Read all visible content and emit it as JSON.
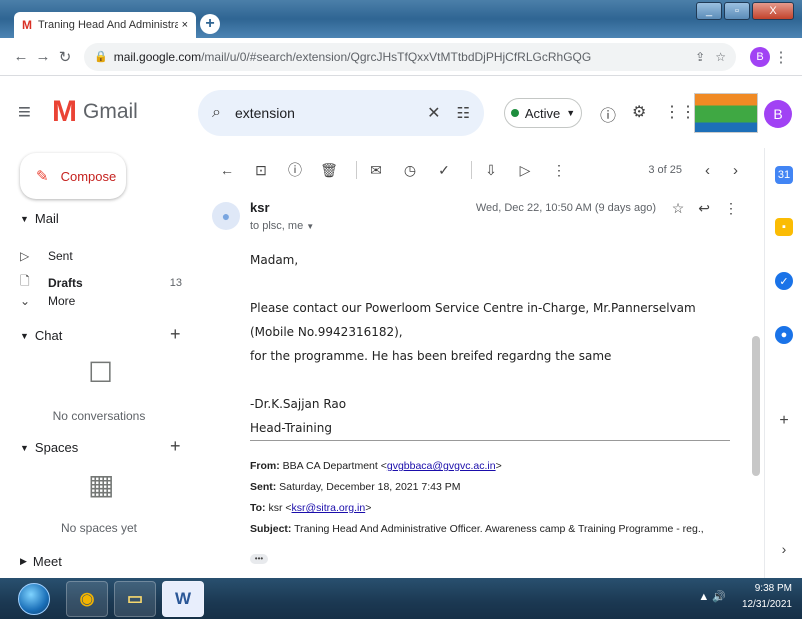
{
  "browser": {
    "tab_title": "Traning Head And Administrative",
    "tab_close": "×",
    "new_tab": "+",
    "url_host": "mail.google.com",
    "url_path": "/mail/u/0/#search/extension/QgrcJHsTfQxxVtMTtbdDjPHjCfRLGcRhGQG",
    "profile_initial": "B",
    "win_min": "_",
    "win_max": "▫",
    "win_close": "X"
  },
  "gmail": {
    "logo_text": "Gmail",
    "search_query": "extension",
    "status": "Active",
    "avatar_initial": "B"
  },
  "sidebar": {
    "compose": "Compose",
    "mail_header": "Mail",
    "items": [
      {
        "label": "Sent",
        "count": ""
      },
      {
        "label": "Drafts",
        "count": "13"
      },
      {
        "label": "More",
        "count": ""
      }
    ],
    "chat_header": "Chat",
    "chat_empty": "No conversations",
    "spaces_header": "Spaces",
    "spaces_empty": "No spaces yet",
    "meet_header": "Meet"
  },
  "toolbar": {
    "pager": "3 of 25"
  },
  "message": {
    "sender": "ksr",
    "to_line": "to plsc, me",
    "date": "Wed, Dec 22, 10:50 AM (9 days ago)",
    "greeting": "Madam,",
    "para1": "Please contact our Powerloom Service Centre in-Charge, Mr.Pannerselvam (Mobile No.9942316182),",
    "para2": "for  the programme.  He has been breifed regardng the same",
    "sig1": "-Dr.K.Sajjan Rao",
    "sig2": "Head-Training",
    "from_label": "From:",
    "from_value": "BBA CA Department <",
    "from_email": "gvgbbaca@gvgvc.ac.in",
    "sent_label": "Sent:",
    "sent_value": "Saturday, December 18, 2021 7:43 PM",
    "to_label": "To:",
    "to_value": "ksr <",
    "to_email": "ksr@sitra.org.in",
    "subject_label": "Subject:",
    "subject_value": "Traning Head And Administrative Officer. Awareness camp & Training Programme - reg.,",
    "ellipsis": "•••"
  },
  "taskbar": {
    "time": "9:38 PM",
    "date": "12/31/2021",
    "word_letter": "W"
  },
  "colors": {
    "gmail_red": "#ea4335",
    "active_green": "#1e8e3e",
    "avatar_purple": "#a142f4",
    "link_blue": "#1a0dab"
  }
}
